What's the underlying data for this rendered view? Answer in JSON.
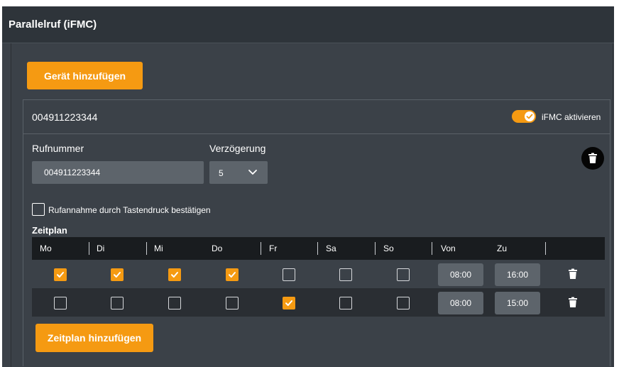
{
  "header": {
    "title": "Parallelruf (iFMC)"
  },
  "toolbar": {
    "add_device_label": "Gerät hinzufügen"
  },
  "device": {
    "number": "004911223344",
    "ifmc_toggle": {
      "label": "iFMC aktivieren",
      "enabled": true
    },
    "phone": {
      "label": "Rufnummer",
      "value": "004911223344"
    },
    "delay": {
      "label": "Verzögerung",
      "value": "5"
    },
    "confirm": {
      "label": "Rufannahme durch Tastendruck bestätigen",
      "checked": false
    },
    "schedule": {
      "label": "Zeitplan",
      "columns": [
        "Mo",
        "Di",
        "Mi",
        "Do",
        "Fr",
        "Sa",
        "So",
        "Von",
        "Zu"
      ],
      "rows": [
        {
          "days": [
            true,
            true,
            true,
            true,
            false,
            false,
            false
          ],
          "from": "08:00",
          "to": "16:00"
        },
        {
          "days": [
            false,
            false,
            false,
            false,
            true,
            false,
            false
          ],
          "from": "08:00",
          "to": "15:00"
        }
      ],
      "add_label": "Zeitplan hinzufügen"
    }
  },
  "colors": {
    "accent": "#f59a12",
    "panel": "#3b4148",
    "header": "#2e343a",
    "table_head": "#191c1f"
  },
  "icons": {
    "toggle_check": "check-icon",
    "delete": "trash-icon",
    "select": "chevron-down-icon"
  }
}
